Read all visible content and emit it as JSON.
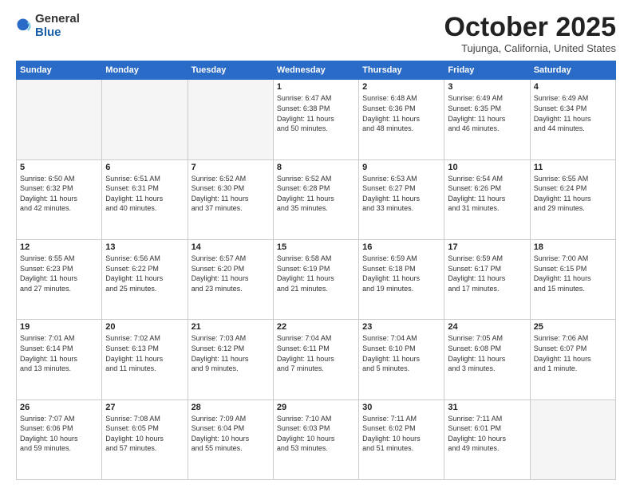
{
  "header": {
    "logo_general": "General",
    "logo_blue": "Blue",
    "title": "October 2025",
    "location": "Tujunga, California, United States"
  },
  "weekdays": [
    "Sunday",
    "Monday",
    "Tuesday",
    "Wednesday",
    "Thursday",
    "Friday",
    "Saturday"
  ],
  "weeks": [
    [
      {
        "day": "",
        "info": ""
      },
      {
        "day": "",
        "info": ""
      },
      {
        "day": "",
        "info": ""
      },
      {
        "day": "1",
        "info": "Sunrise: 6:47 AM\nSunset: 6:38 PM\nDaylight: 11 hours\nand 50 minutes."
      },
      {
        "day": "2",
        "info": "Sunrise: 6:48 AM\nSunset: 6:36 PM\nDaylight: 11 hours\nand 48 minutes."
      },
      {
        "day": "3",
        "info": "Sunrise: 6:49 AM\nSunset: 6:35 PM\nDaylight: 11 hours\nand 46 minutes."
      },
      {
        "day": "4",
        "info": "Sunrise: 6:49 AM\nSunset: 6:34 PM\nDaylight: 11 hours\nand 44 minutes."
      }
    ],
    [
      {
        "day": "5",
        "info": "Sunrise: 6:50 AM\nSunset: 6:32 PM\nDaylight: 11 hours\nand 42 minutes."
      },
      {
        "day": "6",
        "info": "Sunrise: 6:51 AM\nSunset: 6:31 PM\nDaylight: 11 hours\nand 40 minutes."
      },
      {
        "day": "7",
        "info": "Sunrise: 6:52 AM\nSunset: 6:30 PM\nDaylight: 11 hours\nand 37 minutes."
      },
      {
        "day": "8",
        "info": "Sunrise: 6:52 AM\nSunset: 6:28 PM\nDaylight: 11 hours\nand 35 minutes."
      },
      {
        "day": "9",
        "info": "Sunrise: 6:53 AM\nSunset: 6:27 PM\nDaylight: 11 hours\nand 33 minutes."
      },
      {
        "day": "10",
        "info": "Sunrise: 6:54 AM\nSunset: 6:26 PM\nDaylight: 11 hours\nand 31 minutes."
      },
      {
        "day": "11",
        "info": "Sunrise: 6:55 AM\nSunset: 6:24 PM\nDaylight: 11 hours\nand 29 minutes."
      }
    ],
    [
      {
        "day": "12",
        "info": "Sunrise: 6:55 AM\nSunset: 6:23 PM\nDaylight: 11 hours\nand 27 minutes."
      },
      {
        "day": "13",
        "info": "Sunrise: 6:56 AM\nSunset: 6:22 PM\nDaylight: 11 hours\nand 25 minutes."
      },
      {
        "day": "14",
        "info": "Sunrise: 6:57 AM\nSunset: 6:20 PM\nDaylight: 11 hours\nand 23 minutes."
      },
      {
        "day": "15",
        "info": "Sunrise: 6:58 AM\nSunset: 6:19 PM\nDaylight: 11 hours\nand 21 minutes."
      },
      {
        "day": "16",
        "info": "Sunrise: 6:59 AM\nSunset: 6:18 PM\nDaylight: 11 hours\nand 19 minutes."
      },
      {
        "day": "17",
        "info": "Sunrise: 6:59 AM\nSunset: 6:17 PM\nDaylight: 11 hours\nand 17 minutes."
      },
      {
        "day": "18",
        "info": "Sunrise: 7:00 AM\nSunset: 6:15 PM\nDaylight: 11 hours\nand 15 minutes."
      }
    ],
    [
      {
        "day": "19",
        "info": "Sunrise: 7:01 AM\nSunset: 6:14 PM\nDaylight: 11 hours\nand 13 minutes."
      },
      {
        "day": "20",
        "info": "Sunrise: 7:02 AM\nSunset: 6:13 PM\nDaylight: 11 hours\nand 11 minutes."
      },
      {
        "day": "21",
        "info": "Sunrise: 7:03 AM\nSunset: 6:12 PM\nDaylight: 11 hours\nand 9 minutes."
      },
      {
        "day": "22",
        "info": "Sunrise: 7:04 AM\nSunset: 6:11 PM\nDaylight: 11 hours\nand 7 minutes."
      },
      {
        "day": "23",
        "info": "Sunrise: 7:04 AM\nSunset: 6:10 PM\nDaylight: 11 hours\nand 5 minutes."
      },
      {
        "day": "24",
        "info": "Sunrise: 7:05 AM\nSunset: 6:08 PM\nDaylight: 11 hours\nand 3 minutes."
      },
      {
        "day": "25",
        "info": "Sunrise: 7:06 AM\nSunset: 6:07 PM\nDaylight: 11 hours\nand 1 minute."
      }
    ],
    [
      {
        "day": "26",
        "info": "Sunrise: 7:07 AM\nSunset: 6:06 PM\nDaylight: 10 hours\nand 59 minutes."
      },
      {
        "day": "27",
        "info": "Sunrise: 7:08 AM\nSunset: 6:05 PM\nDaylight: 10 hours\nand 57 minutes."
      },
      {
        "day": "28",
        "info": "Sunrise: 7:09 AM\nSunset: 6:04 PM\nDaylight: 10 hours\nand 55 minutes."
      },
      {
        "day": "29",
        "info": "Sunrise: 7:10 AM\nSunset: 6:03 PM\nDaylight: 10 hours\nand 53 minutes."
      },
      {
        "day": "30",
        "info": "Sunrise: 7:11 AM\nSunset: 6:02 PM\nDaylight: 10 hours\nand 51 minutes."
      },
      {
        "day": "31",
        "info": "Sunrise: 7:11 AM\nSunset: 6:01 PM\nDaylight: 10 hours\nand 49 minutes."
      },
      {
        "day": "",
        "info": ""
      }
    ]
  ]
}
